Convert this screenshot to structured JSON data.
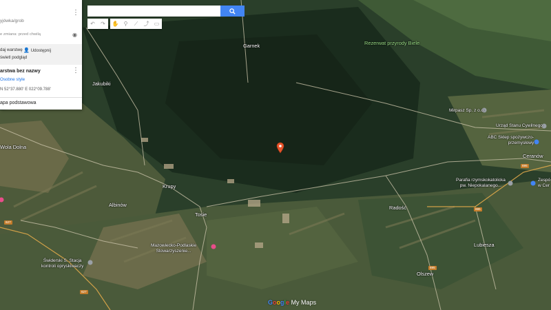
{
  "panel": {
    "title": "yjówka/grob",
    "last_change": "e zmiana: przed chwilą",
    "add_layer": "daj warstwę",
    "share": "Udostępnij",
    "preview": "świetl podgląd",
    "layer_name": "arstwa bez nazwy",
    "style_link": "Osobne style",
    "coordinates": "N 52°37.880' E 022°09.788'",
    "base_map": "apa podstawowa"
  },
  "search": {
    "value": "",
    "placeholder": ""
  },
  "map_labels": {
    "garnek": "Garnek",
    "rezerwat": "Rezerwat przyrody Biele",
    "jakubiki": "Jakubiki",
    "wola_dolna": "Wola Dolna",
    "krupy": "Krupy",
    "albinow": "Albinów",
    "tosie": "Tosie",
    "radosc": "Radość",
    "ceranow": "Ceranów",
    "lubiesza": "Lubiesza",
    "olszew": "Olszew"
  },
  "pois": {
    "mirpasz": "Mirpasz Sp. z o.o.",
    "urzad": "Urząd Stanu Cywilnego",
    "abc": "ABC Sklep spożywczo-\nprzemysłowy",
    "parafia": "Parafia rzymskokatolicka\npw. Niepokalanego...",
    "mazowiecko": "Mazowiecko-Podlaskie\nStowarzyszenie...",
    "swiderski": "Świderski S. Stacja\nkontroli opryskiwaczy",
    "zespol": "Zespó\nw Cer"
  },
  "road_numbers": [
    "627",
    "627",
    "695",
    "695",
    "695"
  ],
  "brand": {
    "google": "Google",
    "mymaps": "My Maps"
  },
  "colors": {
    "marker": "#e8552b",
    "accent": "#4285f4",
    "forest": "#1f3323"
  }
}
